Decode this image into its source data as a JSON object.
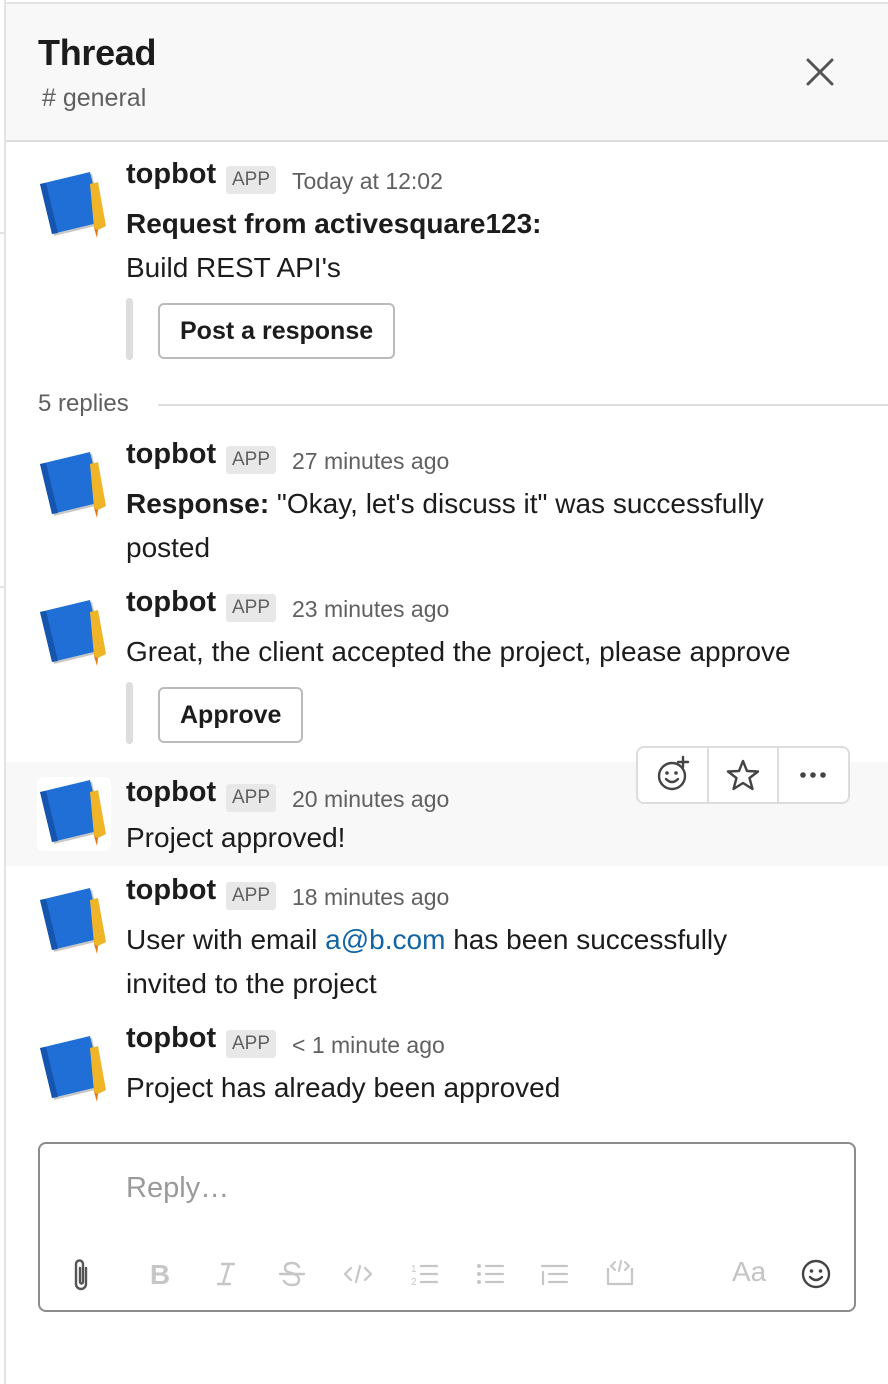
{
  "header": {
    "title": "Thread",
    "channel": "# general"
  },
  "parent": {
    "name": "topbot",
    "badge": "APP",
    "time": "Today at 12:02",
    "title": "Request from activesquare123:",
    "body": "Build REST API's",
    "button": "Post a response"
  },
  "replies_count": "5 replies",
  "replies": [
    {
      "name": "topbot",
      "badge": "APP",
      "time": "27 minutes ago",
      "bold": "Response:",
      "text1": " \"Okay, let's discuss it\" was successfully",
      "text2": "posted"
    },
    {
      "name": "topbot",
      "badge": "APP",
      "time": "23 minutes ago",
      "text1": "Great, the client accepted the project, please approve",
      "button": "Approve"
    },
    {
      "name": "topbot",
      "badge": "APP",
      "time": "20 minutes ago",
      "text1": "Project approved!"
    },
    {
      "name": "topbot",
      "badge": "APP",
      "time": "18 minutes ago",
      "pre": "User with email ",
      "link": "a@b.com",
      "post": " has been successfully",
      "text2": "invited to the project"
    },
    {
      "name": "topbot",
      "badge": "APP",
      "time": "< 1 minute ago",
      "text1": "Project has already been approved"
    }
  ],
  "composer": {
    "placeholder": "Reply…",
    "aa": "Aa"
  },
  "icons": {
    "close": "close-icon",
    "add_reaction": "add-reaction-icon",
    "star": "star-icon",
    "more": "more-actions-icon",
    "attach": "paperclip-icon",
    "bold": "bold-icon",
    "italic": "italic-icon",
    "strike": "strikethrough-icon",
    "code": "code-icon",
    "ordered": "ordered-list-icon",
    "bullets": "bulleted-list-icon",
    "quote": "quote-icon",
    "code_block": "code-block-icon",
    "emoji": "emoji-icon"
  },
  "colors": {
    "avatar_blue": "#1f6fd6",
    "avatar_pencil": "#f0b429",
    "link": "#1264a3",
    "hover_bg": "#f8f8f8"
  }
}
